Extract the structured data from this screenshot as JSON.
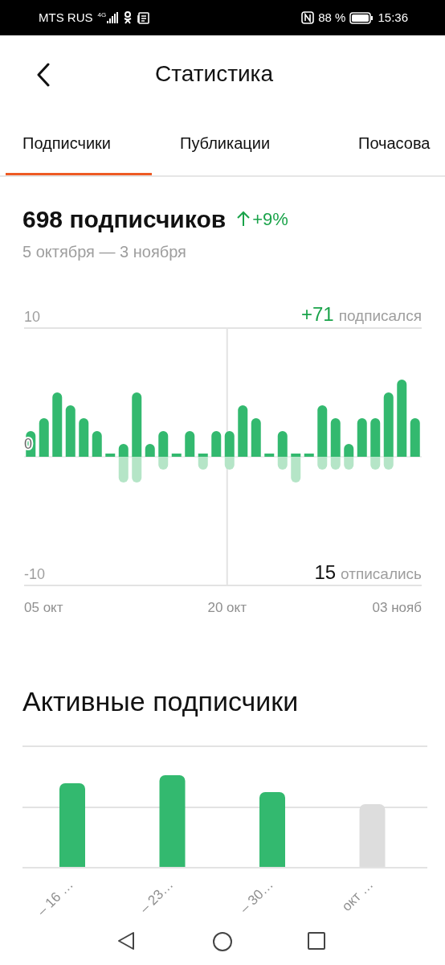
{
  "status_bar": {
    "carrier": "MTS RUS",
    "network": "4G",
    "battery": "88 %",
    "time": "15:36"
  },
  "header": {
    "title": "Статистика"
  },
  "tabs": [
    {
      "label": "Подписчики",
      "selected": true
    },
    {
      "label": "Публикации",
      "selected": false
    },
    {
      "label": "Почасова",
      "selected": false
    }
  ],
  "summary": {
    "count": "698 подписчиков",
    "change": "+9%",
    "period": "5 октября — 3 ноября"
  },
  "subscribers_chart": {
    "subscribed_count": "+71",
    "subscribed_label": "подписался",
    "unsubscribed_count": "15",
    "unsubscribed_label": "отписались",
    "x_labels": [
      "05 окт",
      "20 окт",
      "03 нояб"
    ],
    "chart_data": {
      "type": "bar",
      "stacked": true,
      "categories": [
        null,
        null,
        null,
        null,
        null,
        null,
        null,
        null,
        null,
        null,
        null,
        null,
        null,
        null,
        null,
        null,
        null,
        null,
        null,
        null,
        null,
        null,
        null,
        null,
        null,
        null,
        null,
        null,
        null,
        null
      ],
      "series": [
        {
          "color": "#33b96f",
          "values": [
            2,
            3,
            5,
            4,
            3,
            2,
            0,
            1,
            5,
            1,
            2,
            0,
            2,
            0,
            2,
            2,
            4,
            3,
            0,
            2,
            0,
            0,
            4,
            3,
            1,
            3,
            3,
            5,
            6,
            3
          ]
        },
        {
          "color": "#b5e5c7",
          "values": [
            0,
            0,
            0,
            0,
            0,
            0,
            0,
            -2,
            -2,
            0,
            -1,
            0,
            0,
            -1,
            0,
            -1,
            0,
            0,
            0,
            -1,
            -2,
            0,
            -1,
            -1,
            -1,
            0,
            -1,
            -1,
            0,
            0
          ]
        }
      ],
      "ylim": [
        -10,
        10
      ],
      "yticks": [
        10,
        0,
        -10
      ]
    }
  },
  "active_subscribers": {
    "title": "Активные подписчики",
    "weeks": [
      {
        "label": "– 16 …",
        "kind": "complete"
      },
      {
        "label": "– 23…",
        "kind": "complete"
      },
      {
        "label": "– 30…",
        "kind": "complete"
      },
      {
        "label": "окт …",
        "kind": "partial"
      }
    ]
  }
}
